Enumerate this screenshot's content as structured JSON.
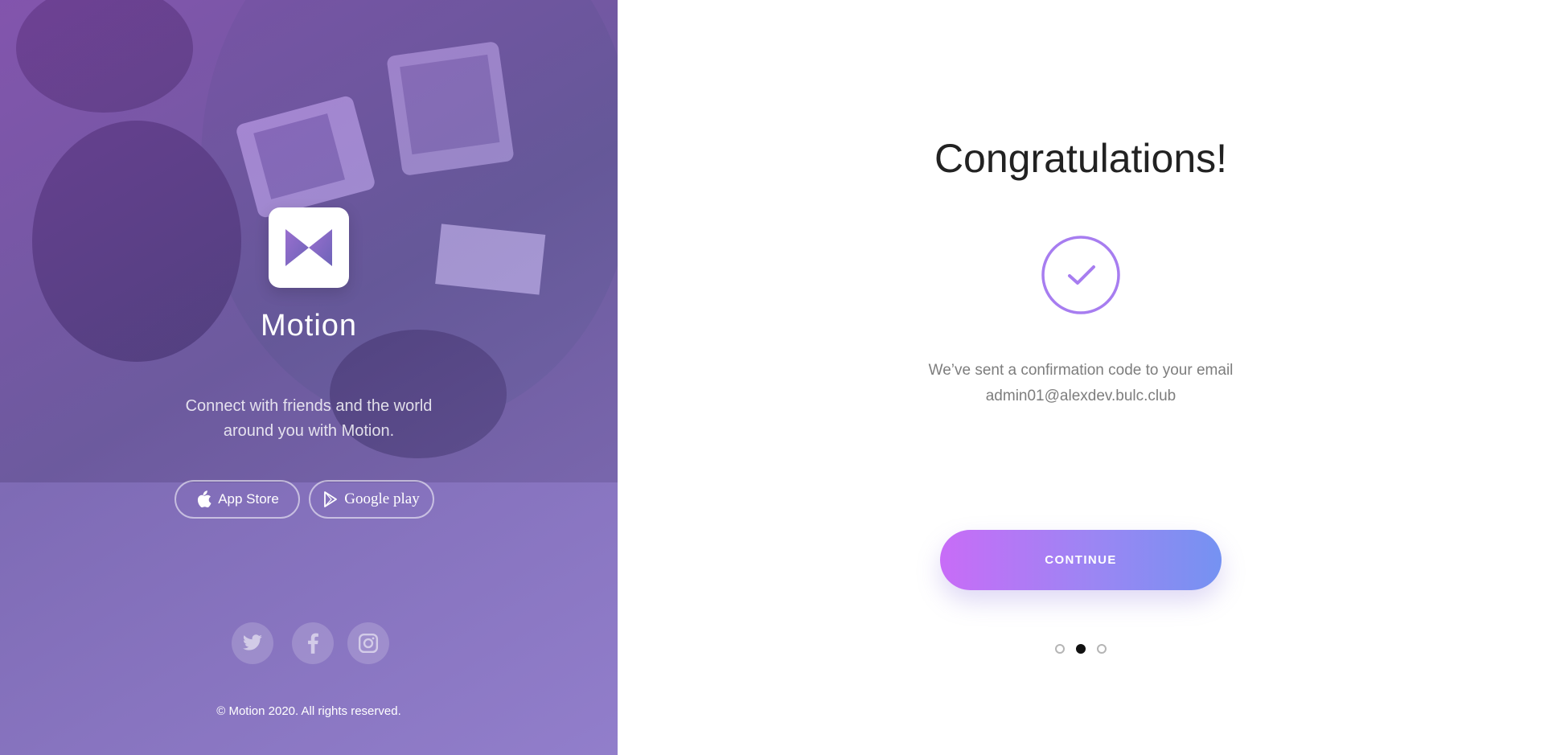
{
  "brand": {
    "name": "Motion",
    "tagline": "Connect with friends and the world around you with Motion.",
    "logo_icon": "bowtie-logo-icon"
  },
  "stores": {
    "app_store": {
      "label": "App Store",
      "icon": "apple-icon"
    },
    "google_play": {
      "label": "Google play",
      "icon": "play-store-icon"
    }
  },
  "social": [
    {
      "name": "twitter",
      "icon": "twitter-icon"
    },
    {
      "name": "facebook",
      "icon": "facebook-icon"
    },
    {
      "name": "instagram",
      "icon": "instagram-icon"
    }
  ],
  "footer": {
    "copyright": "© Motion 2020. All rights reserved."
  },
  "confirmation": {
    "title": "Congratulations!",
    "message_line1": "We’ve sent a confirmation code to your email",
    "email": "admin01@alexdev.bulc.club",
    "continue_label": "CONTINUE",
    "check_icon": "check-circle-icon"
  },
  "pagination": {
    "total": 3,
    "current": 2
  },
  "colors": {
    "accent_start": "#c86cf7",
    "accent_end": "#7592f2",
    "check": "#a77df0"
  }
}
